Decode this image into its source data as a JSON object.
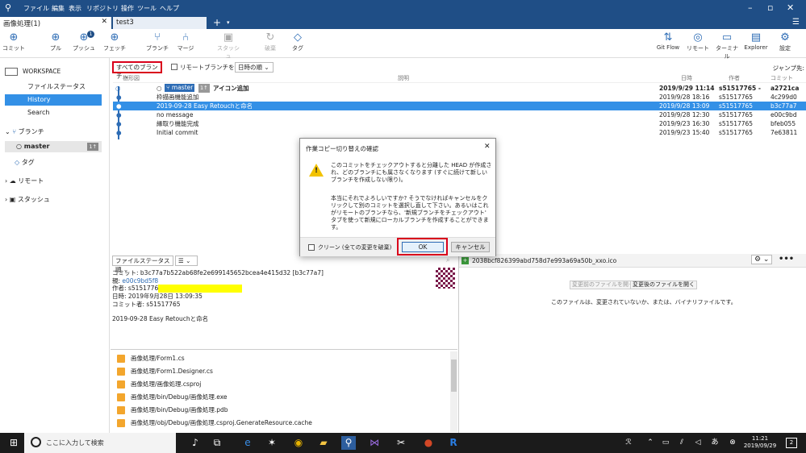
{
  "app": {
    "menu": [
      "ファイル",
      "編集",
      "表示",
      "リポジトリ",
      "操作",
      "ツール",
      "ヘルプ"
    ],
    "tabs": [
      {
        "label": "画像処理(1)"
      },
      {
        "label": "test3"
      }
    ]
  },
  "toolbar": {
    "left": [
      {
        "label": "コミット",
        "icon": "plus-circle-icon"
      },
      {
        "label": "プル",
        "icon": "pull-icon"
      },
      {
        "label": "プッシュ",
        "icon": "push-icon",
        "badge": "1"
      },
      {
        "label": "フェッチ",
        "icon": "fetch-icon"
      },
      {
        "label": "ブランチ",
        "icon": "branch-icon"
      },
      {
        "label": "マージ",
        "icon": "merge-icon"
      },
      {
        "label": "スタッシュ",
        "icon": "stash-icon"
      },
      {
        "label": "破棄",
        "icon": "discard-icon"
      },
      {
        "label": "タグ",
        "icon": "tag-icon"
      }
    ],
    "right": [
      {
        "label": "Git Flow",
        "icon": "git-flow-icon"
      },
      {
        "label": "リモート",
        "icon": "globe-icon"
      },
      {
        "label": "ターミナル",
        "icon": "terminal-icon"
      },
      {
        "label": "Explorer",
        "icon": "folder-icon"
      },
      {
        "label": "設定",
        "icon": "gear-icon"
      }
    ]
  },
  "sidebar": {
    "workspace": "WORKSPACE",
    "items": [
      "ファイルステータス",
      "History",
      "Search"
    ],
    "branches": "ブランチ",
    "master": "master",
    "master_badge": "1↑",
    "tags": "タグ",
    "remotes": "リモート",
    "stashes": "スタッシュ"
  },
  "filters": {
    "all_branches": "すべてのブランチ",
    "show_remote": "リモートブランチを表示",
    "date_order": "日時の順",
    "jump": "ジャンプ先:"
  },
  "columns": {
    "graph": "樹形図",
    "desc": "説明",
    "date": "日時",
    "author": "作者",
    "commit": "コミット"
  },
  "commits": [
    {
      "branch": "master",
      "ahead": "1↑",
      "desc": "アイコン追加",
      "date": "2019/9/29 11:14",
      "author": "s51517765 -",
      "hash": "a2721ca"
    },
    {
      "desc": "枠描画機能追加",
      "date": "2019/9/28 18:16",
      "author": "s51517765",
      "hash": "4c299d0"
    },
    {
      "desc": "2019-09-28 Easy Retouchと命名",
      "date": "2019/9/28 13:09",
      "author": "s51517765",
      "hash": "b3c77a7"
    },
    {
      "desc": "no message",
      "date": "2019/9/28 12:30",
      "author": "s51517765",
      "hash": "e00c9bd"
    },
    {
      "desc": "縁取り機能完成",
      "date": "2019/9/23 16:30",
      "author": "s51517765",
      "hash": "bfeb055"
    },
    {
      "desc": "Initial commit",
      "date": "2019/9/23 15:40",
      "author": "s51517765",
      "hash": "7e63811"
    }
  ],
  "dialog": {
    "title": "作業コピー切り替えの確認",
    "message1": "このコミットをチェックアウトすると分離した HEAD が作成され、どのブランチにも属さなくなります (すぐに続けて新しいブランチを作成しない限り)。",
    "message2": "本当にそれでよろしいですか? そうでなければキャンセルをクリックして別のコミットを選択し直して下さい。あるいはこれがリモートのブランチなら、'新規ブランチをチェックアウト' タブを使って新規にローカルブランチを作成することができます。",
    "clean": "クリーン (全ての変更を破棄)",
    "ok": "OK",
    "cancel": "キャンセル"
  },
  "detail": {
    "sort": "ファイルステータス順",
    "commit_line": "コミット: b3c77a7b522ab68fe2e699145652bcea4e415d32 [b3c77a7]",
    "parent_label": "親:",
    "parent": "e00c9bd5f8",
    "author_line": "作者: s5151776",
    "date_line": "日時: 2019年9月28日 13:09:35",
    "committer_line": "コミット者: s51517765",
    "message": "2019-09-28 Easy Retouchと命名",
    "files": [
      "画像処理/Form1.cs",
      "画像処理/Form1.Designer.cs",
      "画像処理/画像処理.csproj",
      "画像処理/bin/Debug/画像処理.exe",
      "画像処理/bin/Debug/画像処理.pdb",
      "画像処理/obj/Debug/画像処理.csproj.GenerateResource.cache"
    ]
  },
  "diff": {
    "file": "2038bcf826399abd758d7e993a69a50b_xxo.ico",
    "open_before": "変更前のファイルを開く",
    "open_after": "変更後のファイルを開く",
    "note": "このファイルは、変更されていないか、または、バイナリファイルです。"
  },
  "taskbar": {
    "search": "ここに入力して検索",
    "time": "11:21",
    "date": "2019/09/29",
    "notif": "2"
  },
  "colors": {
    "accent": "#1f4e86",
    "select": "#3390e6",
    "highlight": "#d9001b"
  }
}
